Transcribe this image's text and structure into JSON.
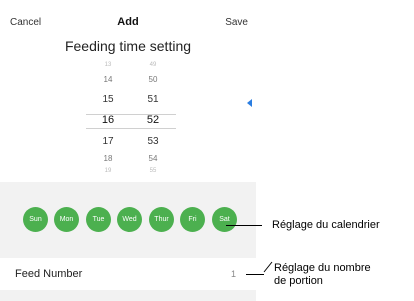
{
  "nav": {
    "cancel": "Cancel",
    "title": "Add",
    "save": "Save"
  },
  "subtitle": "Feeding time setting",
  "picker": {
    "hours": [
      "13",
      "14",
      "15",
      "16",
      "17",
      "18",
      "19"
    ],
    "minutes": [
      "49",
      "50",
      "51",
      "52",
      "53",
      "54",
      "55"
    ],
    "selected_hour": "16",
    "selected_minute": "52"
  },
  "days": [
    "Sun",
    "Mon",
    "Tue",
    "Wed",
    "Thur",
    "Fri",
    "Sat"
  ],
  "day_color": "#4cb04f",
  "feed": {
    "label": "Feed Number",
    "value": "1"
  },
  "callouts": {
    "calendar": "Réglage du calendrier",
    "portion_line1": "Réglage du nombre",
    "portion_line2": "de portion"
  }
}
